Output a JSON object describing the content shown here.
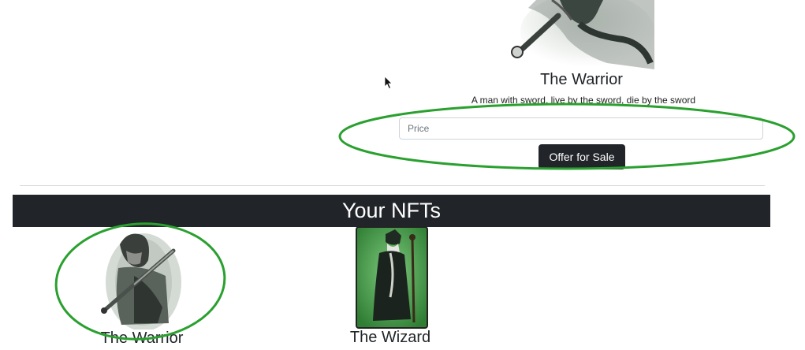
{
  "offer_section": {
    "title": "The Warrior",
    "description": "A man with sword, live by the sword, die by the sword",
    "price_placeholder": "Price",
    "offer_button_label": "Offer for Sale"
  },
  "your_nfts": {
    "heading": "Your NFTs",
    "items": [
      {
        "title": "The Warrior",
        "art": "warrior-image"
      },
      {
        "title": "The Wizard",
        "art": "wizard-image"
      }
    ]
  },
  "annotations": {
    "color": "#2aa02f"
  },
  "colors": {
    "dark": "#212529",
    "wizard_bg": "#3c8f3d"
  }
}
